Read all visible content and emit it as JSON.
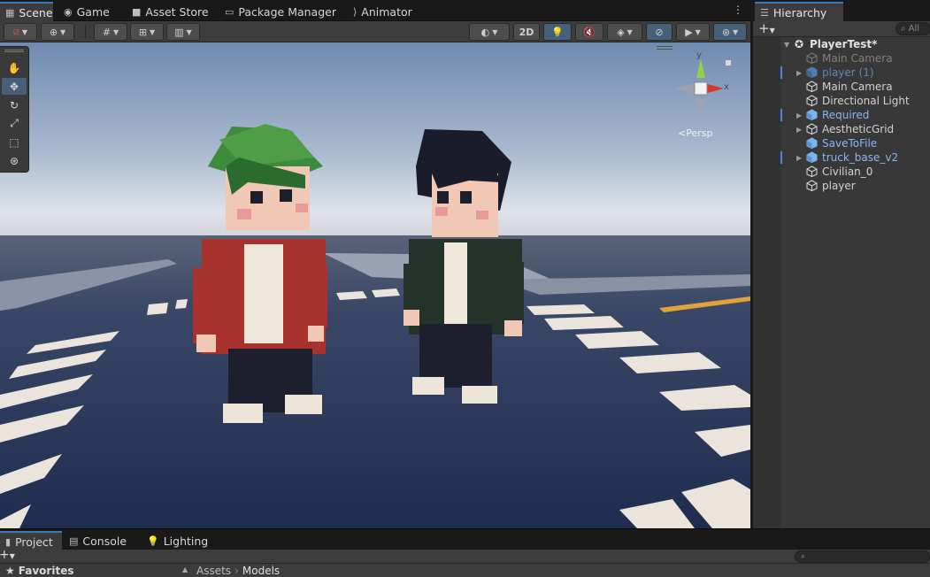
{
  "top_tabs": [
    {
      "label": "Scene",
      "icon": "scene-icon",
      "active": true
    },
    {
      "label": "Game",
      "icon": "game-icon",
      "active": false
    },
    {
      "label": "Asset Store",
      "icon": "asset-store-icon",
      "active": false
    },
    {
      "label": "Package Manager",
      "icon": "package-icon",
      "active": false
    },
    {
      "label": "Animator",
      "icon": "animator-icon",
      "active": false
    }
  ],
  "scene_toolbar": {
    "mode_2d_label": "2D"
  },
  "gizmo": {
    "y_label": "y",
    "x_label": "x",
    "persp_label": "<Persp"
  },
  "hierarchy": {
    "tab_label": "Hierarchy",
    "search_placeholder": "All",
    "scene_name": "PlayerTest*",
    "items": [
      {
        "name": "Main Camera",
        "style": "disabled",
        "expandable": false,
        "icon": "gameobject-icon"
      },
      {
        "name": "player (1)",
        "style": "prefab-disabled",
        "expandable": true,
        "icon": "prefab-icon",
        "marked": true
      },
      {
        "name": "Main Camera",
        "style": "normal",
        "expandable": false,
        "icon": "gameobject-icon"
      },
      {
        "name": "Directional Light",
        "style": "normal",
        "expandable": false,
        "icon": "gameobject-icon"
      },
      {
        "name": "Required",
        "style": "prefab",
        "expandable": true,
        "icon": "prefab-icon",
        "marked": true
      },
      {
        "name": "AestheticGrid",
        "style": "normal",
        "expandable": true,
        "icon": "gameobject-icon"
      },
      {
        "name": "SaveToFile",
        "style": "prefab",
        "expandable": false,
        "icon": "prefab-icon"
      },
      {
        "name": "truck_base_v2",
        "style": "prefab",
        "expandable": true,
        "icon": "prefab-icon",
        "marked": true
      },
      {
        "name": "Civilian_0",
        "style": "normal",
        "expandable": false,
        "icon": "gameobject-icon"
      },
      {
        "name": "player",
        "style": "normal",
        "expandable": false,
        "icon": "gameobject-icon"
      }
    ]
  },
  "bottom_tabs": [
    {
      "label": "Project",
      "icon": "project-icon",
      "active": true
    },
    {
      "label": "Console",
      "icon": "console-icon",
      "active": false
    },
    {
      "label": "Lighting",
      "icon": "lighting-icon",
      "active": false
    }
  ],
  "project": {
    "favorites_label": "Favorites",
    "breadcrumb": [
      "Assets",
      "Models"
    ]
  },
  "colors": {
    "accent": "#3a79bb",
    "prefab_text": "#86b7f2",
    "selected_tool": "#46607c"
  }
}
